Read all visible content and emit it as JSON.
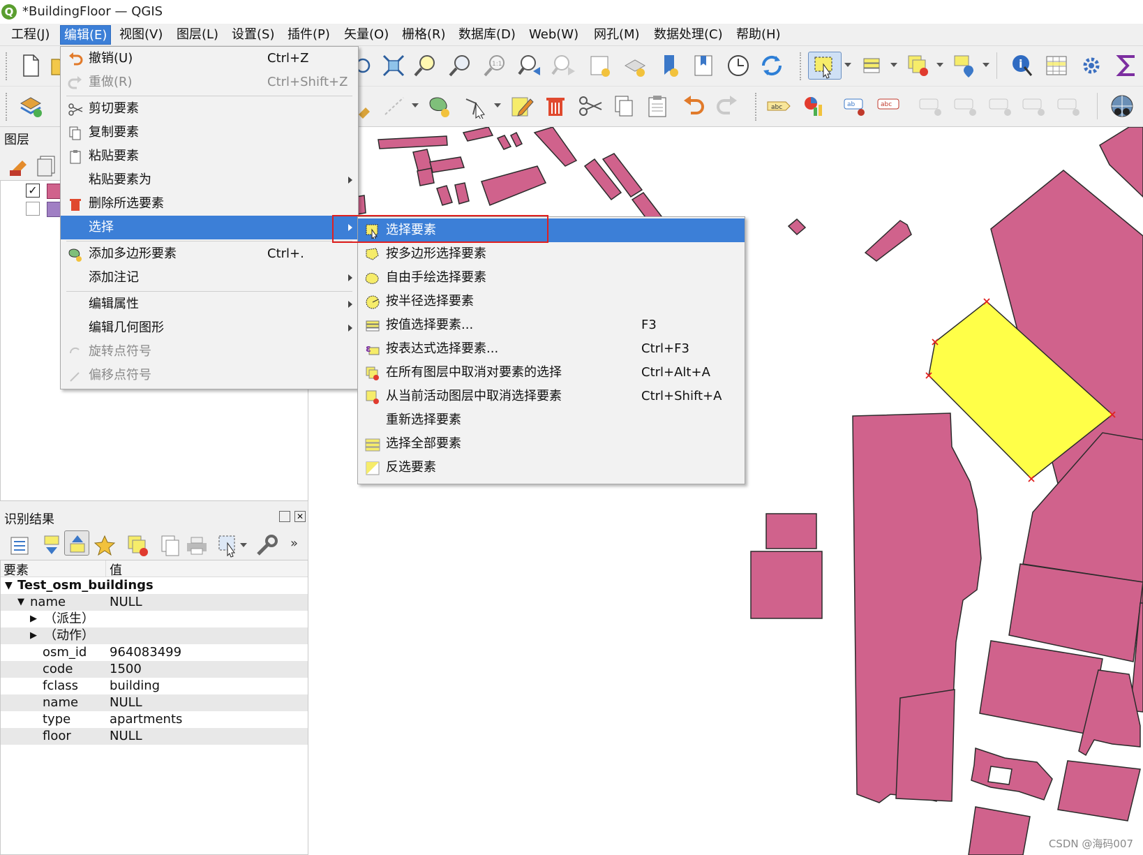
{
  "window": {
    "title": "*BuildingFloor — QGIS",
    "logo": "Q"
  },
  "menubar": [
    "工程(J)",
    "编辑(E)",
    "视图(V)",
    "图层(L)",
    "设置(S)",
    "插件(P)",
    "矢量(O)",
    "栅格(R)",
    "数据库(D)",
    "Web(W)",
    "网孔(M)",
    "数据处理(C)",
    "帮助(H)"
  ],
  "edit_menu": [
    {
      "label": "撤销(U)",
      "shortcut": "Ctrl+Z",
      "icon": "undo-icon"
    },
    {
      "label": "重做(R)",
      "shortcut": "Ctrl+Shift+Z",
      "icon": "redo-icon",
      "disabled": true
    },
    {
      "label": "剪切要素",
      "icon": "scissors-icon"
    },
    {
      "label": "复制要素",
      "icon": "copy-icon"
    },
    {
      "label": "粘贴要素",
      "icon": "paste-icon"
    },
    {
      "label": "粘贴要素为",
      "submenu": true
    },
    {
      "label": "删除所选要素",
      "icon": "trash-icon"
    },
    {
      "label": "选择",
      "submenu": true,
      "highlighted": true
    },
    {
      "label": "添加多边形要素",
      "shortcut": "Ctrl+.",
      "icon": "add-polygon-icon"
    },
    {
      "label": "添加注记",
      "submenu": true
    },
    {
      "label": "编辑属性",
      "submenu": true
    },
    {
      "label": "编辑几何图形",
      "submenu": true
    },
    {
      "label": "旋转点符号",
      "icon": "rotate-point-icon",
      "disabled": true
    },
    {
      "label": "偏移点符号",
      "icon": "offset-point-icon",
      "disabled": true
    }
  ],
  "select_submenu": [
    {
      "label": "选择要素",
      "icon": "select-feature-icon",
      "highlighted": true
    },
    {
      "label": "按多边形选择要素",
      "icon": "select-polygon-icon"
    },
    {
      "label": "自由手绘选择要素",
      "icon": "select-freehand-icon"
    },
    {
      "label": "按半径选择要素",
      "icon": "select-radius-icon"
    },
    {
      "label": "按值选择要素...",
      "shortcut": "F3",
      "icon": "select-by-value-icon"
    },
    {
      "label": "按表达式选择要素...",
      "shortcut": "Ctrl+F3",
      "icon": "select-by-expression-icon"
    },
    {
      "label": "在所有图层中取消对要素的选择",
      "shortcut": "Ctrl+Alt+A",
      "icon": "deselect-all-layers-icon"
    },
    {
      "label": "从当前活动图层中取消选择要素",
      "shortcut": "Ctrl+Shift+A",
      "icon": "deselect-active-layer-icon"
    },
    {
      "label": "重新选择要素"
    },
    {
      "label": "选择全部要素",
      "icon": "select-all-icon"
    },
    {
      "label": "反选要素",
      "icon": "invert-selection-icon"
    }
  ],
  "layers_panel": {
    "title": "图层"
  },
  "identify_panel": {
    "title": "识别结果",
    "col_feature": "要素",
    "col_value": "值",
    "layer_name": "Test_osm_buildings",
    "rows": [
      {
        "key": "name",
        "value": "NULL"
      },
      {
        "key": "（派生）",
        "value": ""
      },
      {
        "key": "（动作）",
        "value": ""
      },
      {
        "key": "osm_id",
        "value": "964083499"
      },
      {
        "key": "code",
        "value": "1500"
      },
      {
        "key": "fclass",
        "value": "building"
      },
      {
        "key": "name",
        "value": "NULL"
      },
      {
        "key": "type",
        "value": "apartments"
      },
      {
        "key": "floor",
        "value": "NULL"
      }
    ]
  },
  "colors": {
    "building": "#d0628c",
    "selected": "#ffff48",
    "highlight": "#3c7fd7",
    "marker": "#e0201f"
  },
  "watermark": "CSDN @海码007"
}
